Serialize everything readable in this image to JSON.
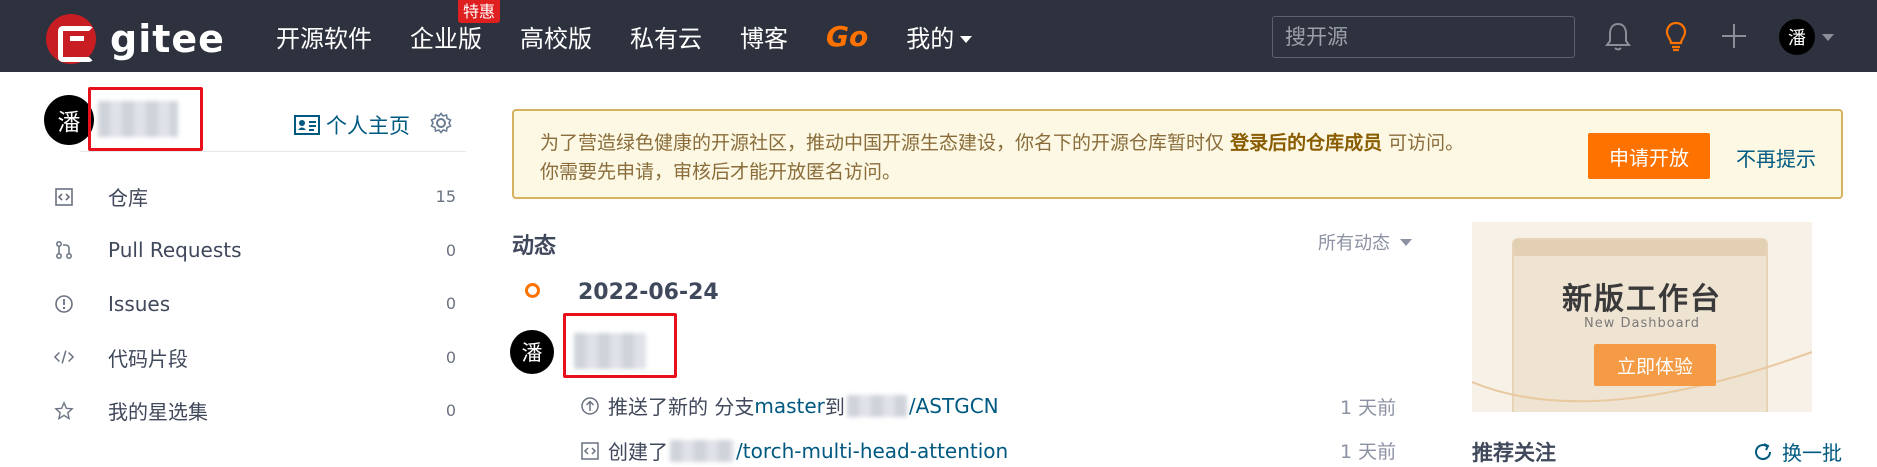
{
  "brand": {
    "name": "gitee"
  },
  "nav": {
    "items": [
      {
        "label": "开源软件"
      },
      {
        "label": "企业版",
        "badge": "特惠"
      },
      {
        "label": "高校版"
      },
      {
        "label": "私有云"
      },
      {
        "label": "博客"
      },
      {
        "label": "Go"
      },
      {
        "label": "我的"
      }
    ],
    "search_placeholder": "搜开源",
    "user_initial": "潘"
  },
  "sidebar": {
    "user_initial": "潘",
    "homepage_label": "个人主页",
    "items": [
      {
        "label": "仓库",
        "count": "15",
        "icon": "repo-icon"
      },
      {
        "label": "Pull Requests",
        "count": "0",
        "icon": "pull-request-icon"
      },
      {
        "label": "Issues",
        "count": "0",
        "icon": "issue-icon"
      },
      {
        "label": "代码片段",
        "count": "0",
        "icon": "code-snippet-icon"
      },
      {
        "label": "我的星选集",
        "count": "0",
        "icon": "star-icon"
      }
    ]
  },
  "notice": {
    "text_before": "为了营造绿色健康的开源社区，推动中国开源生态建设，你名下的开源仓库暂时仅",
    "text_bold": "登录后的仓库成员",
    "text_after": "可访问。",
    "text_line2": "你需要先申请，审核后才能开放匿名访问。",
    "apply_button": "申请开放",
    "dismiss_link": "不再提示"
  },
  "feed": {
    "title": "动态",
    "filter_label": "所有动态",
    "date": "2022-06-24",
    "user_initial": "潘",
    "events": [
      {
        "prefix": "推送了新的 分支 ",
        "branch": "master",
        "mid": " 到 ",
        "repo": "/ASTGCN",
        "time": "1 天前",
        "icon": "push-icon"
      },
      {
        "prefix": "创建了 ",
        "repo": "/torch-multi-head-attention",
        "time": "1 天前",
        "icon": "repo-create-icon"
      }
    ]
  },
  "promo": {
    "title": "新版工作台",
    "subtitle": "New Dashboard",
    "button": "立即体验"
  },
  "recommend": {
    "title": "推荐关注",
    "refresh_label": "换一批"
  },
  "colors": {
    "nav_bg": "#2e323e",
    "brand_red": "#c71d23",
    "accent_orange": "#fe7300",
    "link_blue": "#005980",
    "notice_bg": "#fcf8e3",
    "notice_border": "#d6b25e",
    "annotation_red": "#e8111b"
  }
}
